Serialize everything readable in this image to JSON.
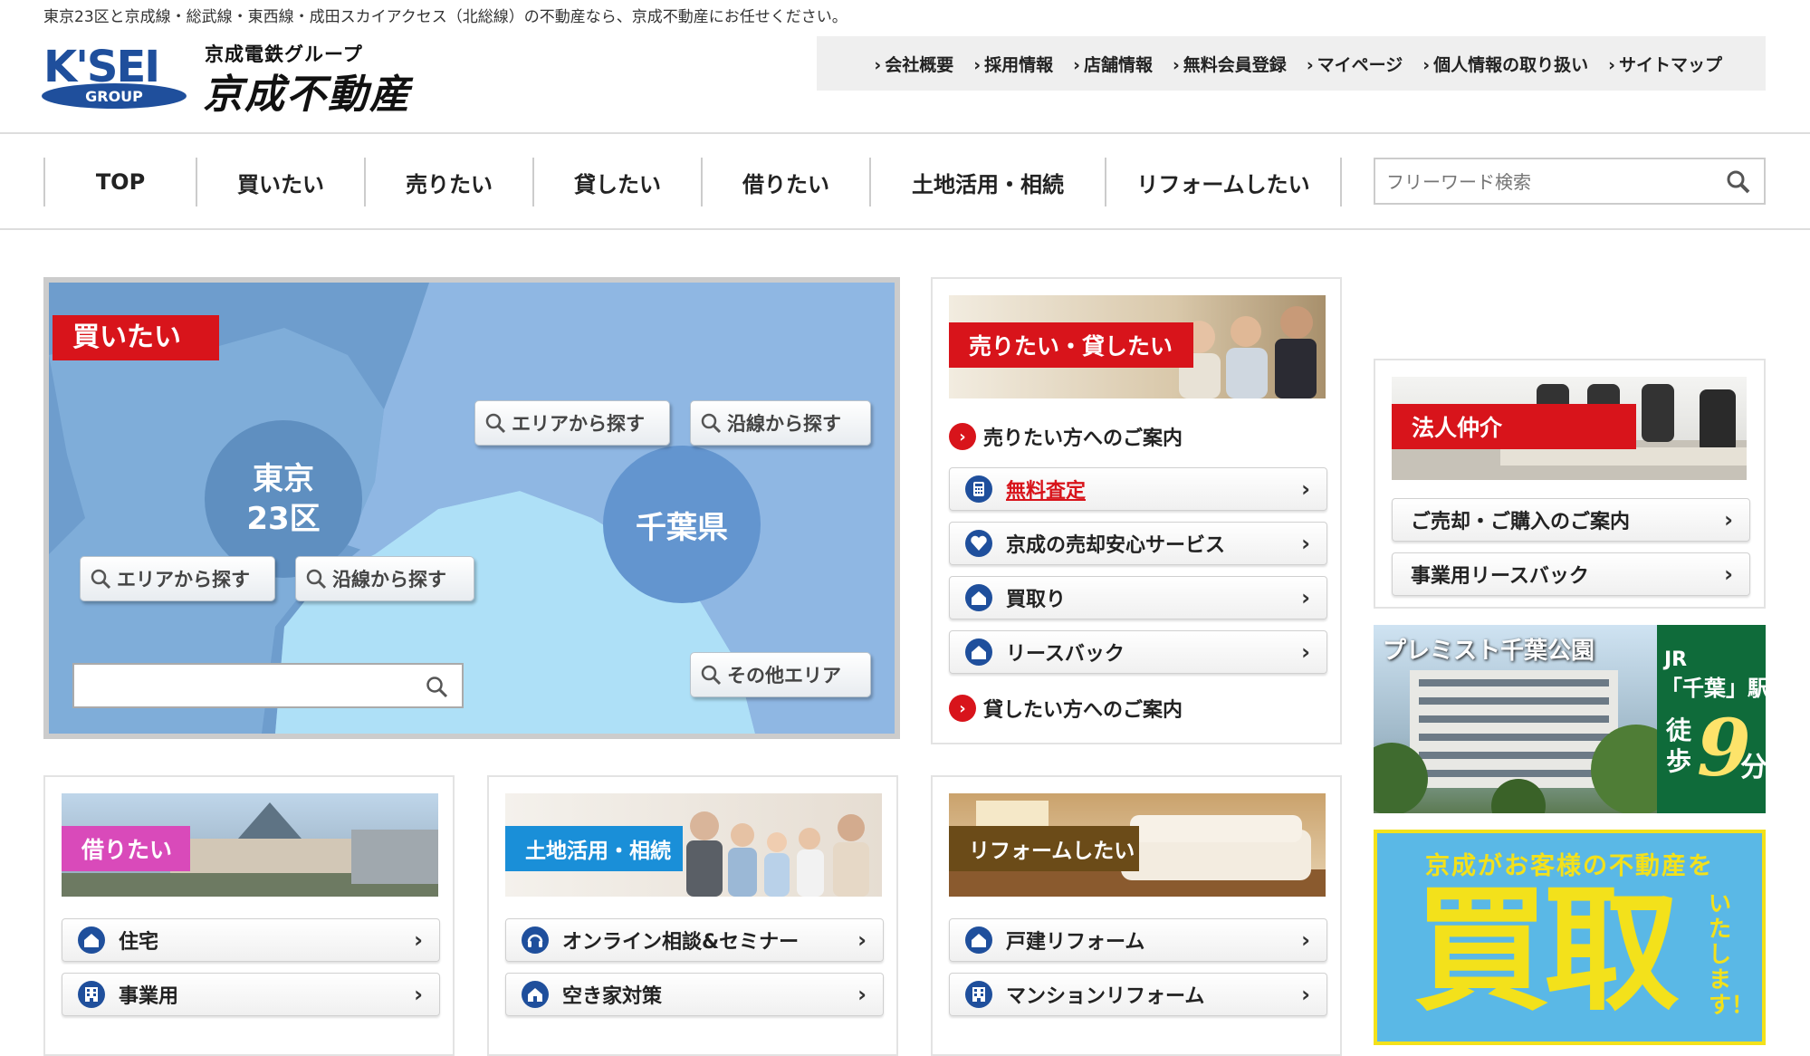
{
  "tagline": "東京23区と京成線・総武線・東西線・成田スカイアクセス（北総線）の不動産なら、京成不動産にお任せください。",
  "logo": {
    "mark": "K'SEI",
    "group": "GROUP",
    "sub": "京成電鉄グループ",
    "name": "京成不動産"
  },
  "util_nav": [
    "会社概要",
    "採用情報",
    "店舗情報",
    "無料会員登録",
    "マイページ",
    "個人情報の取り扱い",
    "サイトマップ"
  ],
  "global_nav": [
    "TOP",
    "買いたい",
    "売りたい",
    "貸したい",
    "借りたい",
    "土地活用・相続",
    "リフォームしたい"
  ],
  "search": {
    "placeholder": "フリーワード検索"
  },
  "buy": {
    "label": "買いたい",
    "tokyo": "東京\n23区",
    "chiba": "千葉県",
    "tokyo_area": "エリアから探す",
    "tokyo_line": "沿線から探す",
    "chiba_area": "エリアから探す",
    "chiba_line": "沿線から探す",
    "other": "その他エリア"
  },
  "sell": {
    "label": "売りたい・貸したい",
    "sell_guide": "売りたい方へのご案内",
    "items": [
      "無料査定",
      "京成の売却安心サービス",
      "買取り",
      "リースバック"
    ],
    "lend_guide": "貸したい方へのご案内"
  },
  "corp": {
    "label": "法人仲介",
    "items": [
      "ご売却・ご購入のご案内",
      "事業用リースバック"
    ]
  },
  "ad1": {
    "title": "プレミスト千葉公園",
    "line1": "JR",
    "line2": "「千葉」駅",
    "walk": "徒歩",
    "minutes": "9",
    "unit": "分"
  },
  "ad2": {
    "top": "京成がお客様の不動産を",
    "big": "買取",
    "side": "いたします！"
  },
  "rent": {
    "label": "借りたい",
    "items": [
      "住宅",
      "事業用"
    ]
  },
  "land": {
    "label": "土地活用・相続",
    "items": [
      "オンライン相談&セミナー",
      "空き家対策"
    ]
  },
  "reform": {
    "label": "リフォームしたい",
    "items": [
      "戸建リフォーム",
      "マンションリフォーム"
    ]
  },
  "colors": {
    "red": "#d8141b",
    "brand_blue": "#1f4f9c",
    "map_sea": "#8fb7e3"
  }
}
